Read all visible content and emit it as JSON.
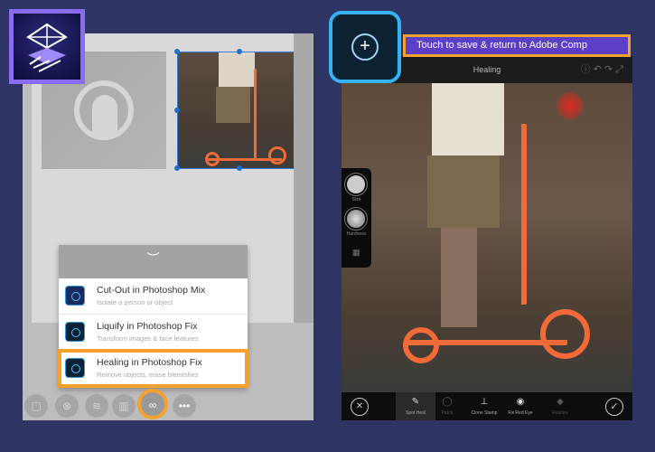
{
  "app_icon": "adobe-comp-logo",
  "menu": {
    "collapse_glyph": "︶",
    "items": [
      {
        "title": "Cut-Out in Photoshop Mix",
        "subtitle": "Isolate a person or object"
      },
      {
        "title": "Liquify in Photoshop Fix",
        "subtitle": "Transform images & face features"
      },
      {
        "title": "Healing in Photoshop Fix",
        "subtitle": "Remove objects, erase blemishes"
      }
    ]
  },
  "toolbar": {
    "more_label": "•••"
  },
  "callout": {
    "text": "Touch to save & return to Adobe Comp"
  },
  "editor": {
    "title": "Healing",
    "brush": {
      "size_label": "Size",
      "hardness_label": "Hardness"
    },
    "tools": [
      {
        "label": "Spot Heal",
        "glyph": "✎"
      },
      {
        "label": "Patch",
        "glyph": "◯"
      },
      {
        "label": "Clone Stamp",
        "glyph": "⊥"
      },
      {
        "label": "Fix Red Eye",
        "glyph": "◉"
      },
      {
        "label": "Restore",
        "glyph": "◆"
      }
    ],
    "cancel_glyph": "✕",
    "confirm_glyph": "✓"
  },
  "colors": {
    "background": "#2e3463",
    "highlight": "#f4a12e",
    "callout": "#5c3ec7",
    "accent": "#34b3f0",
    "scooter": "#f26a3a"
  }
}
